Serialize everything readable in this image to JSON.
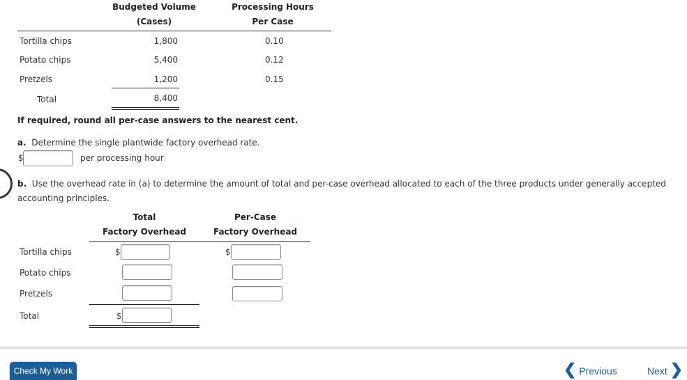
{
  "table1": {
    "col1_header": [
      "Budgeted Volume",
      "(Cases)"
    ],
    "col2_header": [
      "Processing Hours",
      "Per Case"
    ],
    "rows": [
      {
        "label": "Tortilla chips",
        "volume": "1,800",
        "hours": "0.10"
      },
      {
        "label": "Potato chips",
        "volume": "5,400",
        "hours": "0.12"
      },
      {
        "label": "Pretzels",
        "volume": "1,200",
        "hours": "0.15"
      }
    ],
    "total": {
      "label": "Total",
      "volume": "8,400"
    }
  },
  "instruction": "If required, round all per-case answers to the nearest cent.",
  "part_a": {
    "letter": "a.",
    "text": "Determine the single plantwide factory overhead rate.",
    "currency": "$",
    "input_value": "",
    "unit_label": "per processing hour"
  },
  "part_b": {
    "letter": "b.",
    "text": "Use the overhead rate in (a) to determine the amount of total and per-case overhead allocated to each of the three products under generally accepted accounting principles."
  },
  "table2": {
    "col1_header": [
      "Total",
      "Factory Overhead"
    ],
    "col2_header": [
      "Per-Case",
      "Factory Overhead"
    ],
    "currency": "$",
    "rows": [
      {
        "label": "Tortilla chips",
        "total_value": "",
        "per_case_value": ""
      },
      {
        "label": "Potato chips",
        "total_value": "",
        "per_case_value": ""
      },
      {
        "label": "Pretzels",
        "total_value": "",
        "per_case_value": ""
      }
    ],
    "total": {
      "label": "Total",
      "total_value": ""
    }
  },
  "footer": {
    "check_button": "Check My Work",
    "previous_label": "Previous",
    "next_label": "Next",
    "previous_icon": "chevron-left-icon",
    "next_icon": "chevron-right-icon"
  },
  "colors": {
    "accent": "#1d5d96",
    "text": "#333333"
  }
}
